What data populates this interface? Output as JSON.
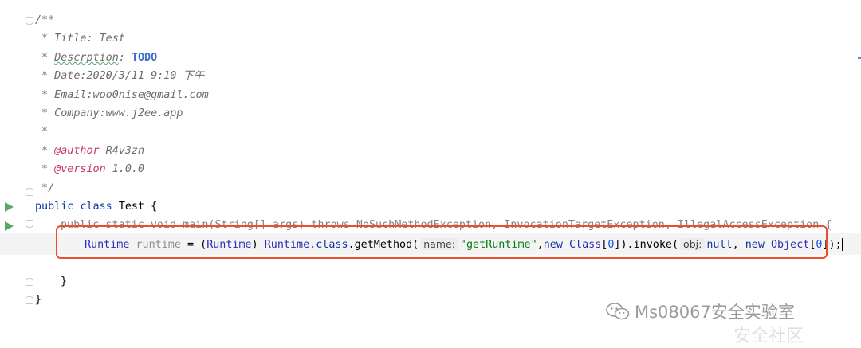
{
  "editor": {
    "comment": {
      "open": "/**",
      "title": " * Title: Test",
      "desc_prefix": " * ",
      "desc_word": "Descrption",
      "desc_colon": ": ",
      "desc_todo": "TODO",
      "date": " * Date:2020/3/11 9:10 下午",
      "email": " * Email:woo0nise@gmail.com",
      "company": " * Company:www.j2ee.app",
      "blank": " *",
      "author_prefix": " * ",
      "author_tag": "@author",
      "author_value": " R4v3zn",
      "version_prefix": " * ",
      "version_tag": "@version",
      "version_value": " 1.0.0",
      "close": " */"
    },
    "class_decl": {
      "public": "public",
      "class": "class",
      "name": "Test",
      "brace": " {"
    },
    "main_decl": {
      "text": "public static void main(String[] args) throws NoSuchMethodException, InvocationTargetException, IllegalAccessException {"
    },
    "statement": {
      "type": "Runtime",
      "var": "runtime",
      "eq": " = (",
      "cast": "Runtime",
      "close_cast": ") ",
      "recv": "Runtime",
      "dot1": ".",
      "class_kw": "class",
      "get_method": ".getMethod(",
      "hint_name": "name:",
      "str": "\"getRuntime\"",
      "comma": ",",
      "new1": "new",
      "class_type": "Class",
      "arr1_open": "[",
      "zero1": "0",
      "arr1_close": "]).invoke(",
      "hint_obj": "obj:",
      "null_kw": "null",
      "comma2": ", ",
      "new2": "new",
      "object_type": "Object",
      "arr2_open": "[",
      "zero2": "0",
      "arr2_close": "]);"
    },
    "close_main": "}",
    "close_class": "}"
  },
  "watermark": {
    "text": "Ms08067安全实验室",
    "icon": "wechat-icon",
    "text2": "安全社区"
  },
  "colors": {
    "highlight_box": "#e9502c",
    "run_icon": "#59a869",
    "keyword": "#0f35a6",
    "string": "#067d17"
  }
}
